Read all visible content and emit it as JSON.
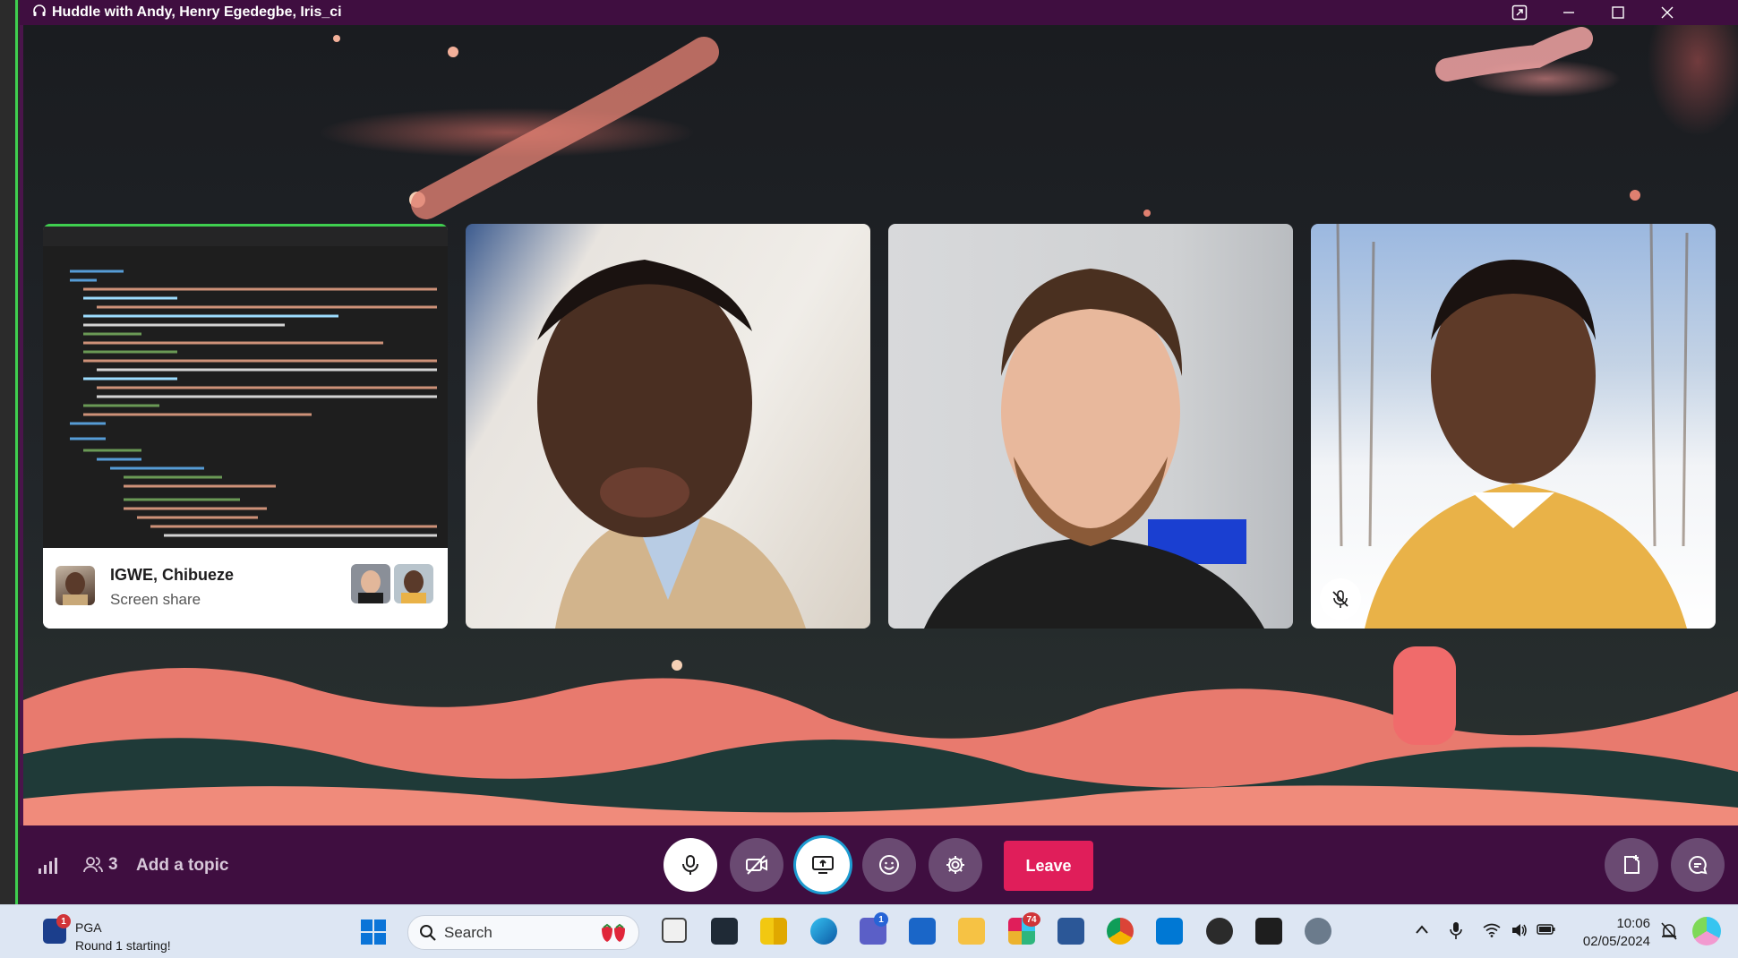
{
  "titlebar": {
    "title": "Huddle with Andy, Henry Egedegbe, Iris_ci"
  },
  "screen_share": {
    "presenter_name": "IGWE, Chibueze",
    "label": "Screen share"
  },
  "mute_icon": "microphone-muted-icon",
  "footer": {
    "participant_count": "3",
    "topic_placeholder": "Add a topic",
    "leave_label": "Leave"
  },
  "taskbar": {
    "notification_app": "PGA",
    "notification_text": "Round 1 starting!",
    "notification_badge": "1",
    "search_label": "Search",
    "teams_badge": "1",
    "slack_badge": "74",
    "time": "10:06",
    "date": "02/05/2024"
  },
  "colors": {
    "titlebar": "#3f0e40",
    "leave": "#e01e5a",
    "taskbar": "#dde6f3"
  }
}
